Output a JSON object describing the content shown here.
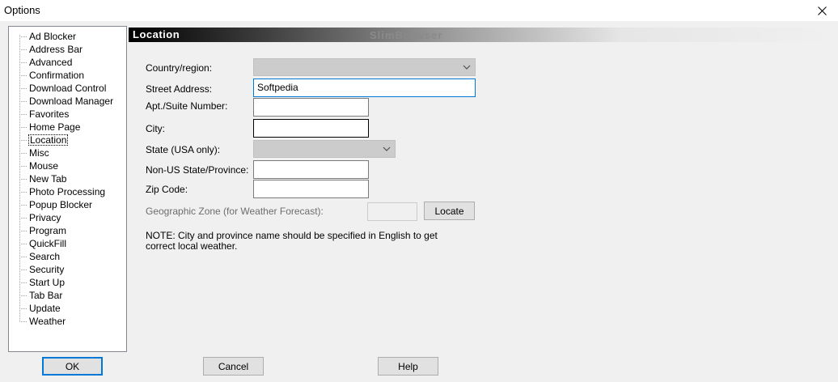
{
  "window": {
    "title": "Options",
    "close_label": "✕"
  },
  "tree": {
    "items": [
      "Ad Blocker",
      "Address Bar",
      "Advanced",
      "Confirmation",
      "Download Control",
      "Download Manager",
      "Favorites",
      "Home Page",
      "Location",
      "Misc",
      "Mouse",
      "New Tab",
      "Photo Processing",
      "Popup Blocker",
      "Privacy",
      "Program",
      "QuickFill",
      "Search",
      "Security",
      "Start Up",
      "Tab Bar",
      "Update",
      "Weather"
    ],
    "selected_index": 8
  },
  "banner": {
    "title": "Location",
    "brand": "SlimBrowser"
  },
  "form": {
    "country_label": "Country/region:",
    "country_value": "",
    "street_label": "Street Address:",
    "street_value": "Softpedia",
    "apt_label": "Apt./Suite Number:",
    "apt_value": "",
    "city_label": "City:",
    "city_value": "",
    "state_label": "State (USA only):",
    "state_value": "",
    "province_label": "Non-US State/Province:",
    "province_value": "",
    "zip_label": "Zip Code:",
    "zip_value": "",
    "geo_label": "Geographic Zone (for Weather Forecast):",
    "geo_value": "",
    "locate_label": "Locate",
    "note": "NOTE: City and province name should be specified in English to get correct local weather."
  },
  "buttons": {
    "ok": "OK",
    "cancel": "Cancel",
    "help": "Help"
  },
  "colors": {
    "accent": "#0078d7",
    "selection_border": "#000000"
  }
}
